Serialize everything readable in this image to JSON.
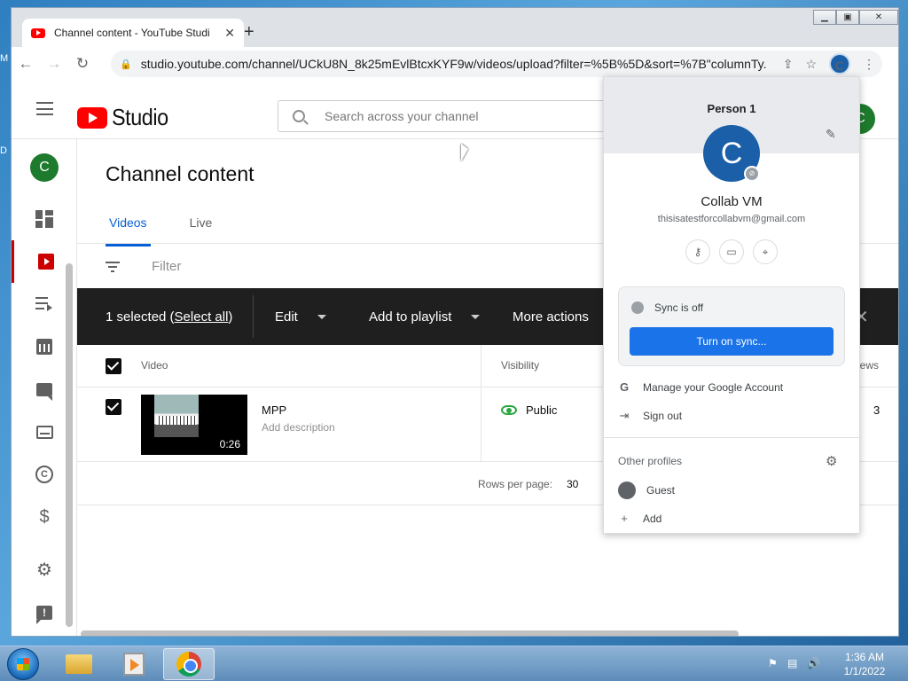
{
  "browser": {
    "tab_title": "Channel content - YouTube Studio",
    "url": "studio.youtube.com/channel/UCkU8N_8k25mEvlBtcxKYF9w/videos/upload?filter=%5B%5D&sort=%7B\"columnTy...",
    "profile_initial": "C"
  },
  "header": {
    "logo_text": "Studio",
    "search_placeholder": "Search across your channel",
    "avatar_initial": "C"
  },
  "sidebar": {
    "avatar_initial": "C"
  },
  "content": {
    "title": "Channel content",
    "tabs": [
      "Videos",
      "Live"
    ],
    "filter_placeholder": "Filter",
    "action_bar": {
      "selected_prefix": "1 selected (",
      "select_all": "Select all",
      "selected_suffix": ")",
      "edit": "Edit",
      "add_to_playlist": "Add to playlist",
      "more_actions": "More actions"
    },
    "columns": {
      "video": "Video",
      "visibility": "Visibility",
      "views": "iews"
    },
    "rows": [
      {
        "title": "MPP",
        "description": "Add description",
        "duration": "0:26",
        "visibility": "Public",
        "views": "3"
      }
    ],
    "pager": {
      "label": "Rows per page:",
      "value": "30"
    }
  },
  "profile_popup": {
    "profile_name": "Person 1",
    "initial": "C",
    "display_name": "Collab VM",
    "email": "thisisatestforcollabvm@gmail.com",
    "sync_status": "Sync is off",
    "sync_button": "Turn on sync...",
    "manage_account": "Manage your Google Account",
    "sign_out": "Sign out",
    "other_profiles": "Other profiles",
    "guest": "Guest",
    "add": "Add"
  },
  "taskbar": {
    "time": "1:36 AM",
    "date": "1/1/2022"
  },
  "colors": {
    "brand_red": "#ff0000",
    "accent_blue": "#065fd4",
    "sync_blue": "#1a73e8",
    "public_green": "#2ba640"
  }
}
